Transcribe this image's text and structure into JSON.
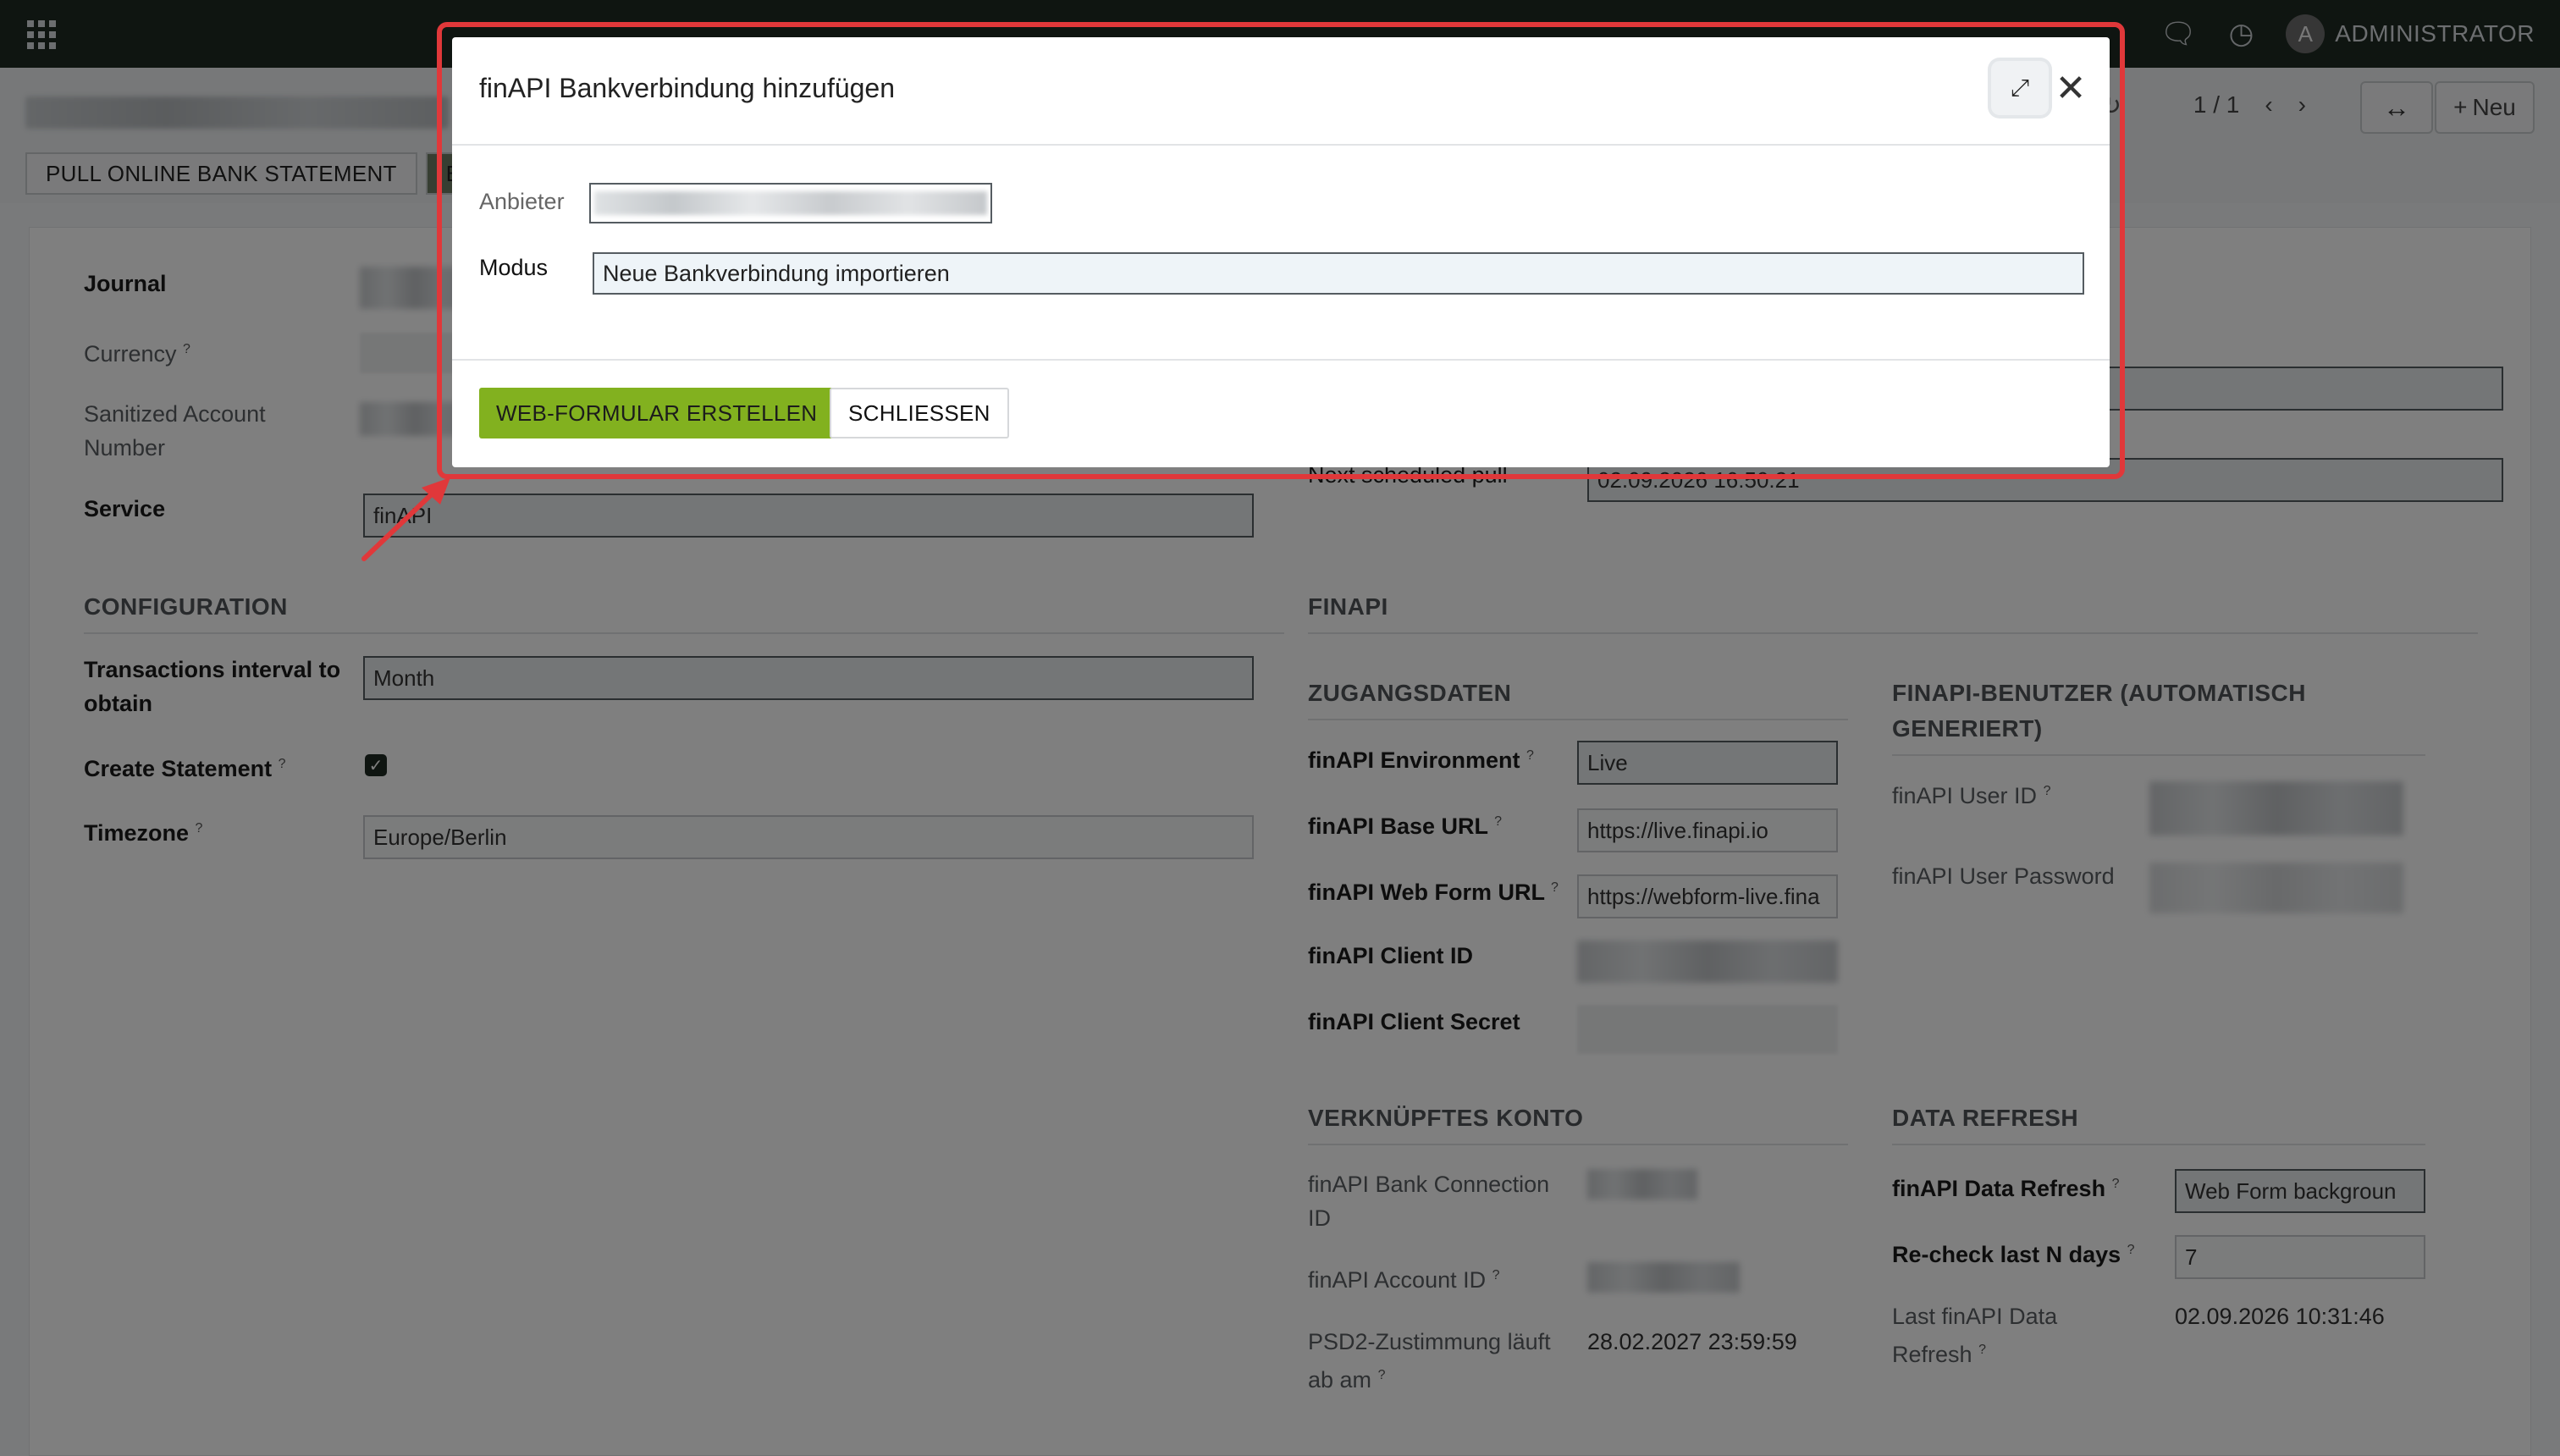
{
  "navbar": {
    "user_initial": "A",
    "user_name": "ADMINISTRATOR"
  },
  "control": {
    "pager": "1 / 1",
    "new_label": "Neu",
    "status_buttons": [
      "PULL ONLINE BANK STATEMENT",
      "B"
    ]
  },
  "form": {
    "journal_label": "Journal",
    "currency_label": "Currency",
    "sanitized_label_1": "Sanitized Account",
    "sanitized_label_2": "Number",
    "service_label": "Service",
    "service_value": "finAPI",
    "next_pull_label": "Next scheduled pull",
    "next_pull_value": "02.09.2026 16:50:21",
    "configuration_title": "CONFIGURATION",
    "interval_label_1": "Transactions interval to",
    "interval_label_2": "obtain",
    "interval_value": "Month",
    "create_statement_label": "Create Statement",
    "timezone_label": "Timezone",
    "timezone_value": "Europe/Berlin",
    "finapi_title": "FINAPI",
    "zugangsdaten_title": "ZUGANGSDATEN",
    "env_label": "finAPI Environment",
    "env_value": "Live",
    "base_url_label": "finAPI Base URL",
    "base_url_value": "https://live.finapi.io",
    "webform_url_label": "finAPI Web Form URL",
    "webform_url_value": "https://webform-live.fina",
    "client_id_label": "finAPI Client ID",
    "client_secret_label": "finAPI Client Secret",
    "benutzer_title_1": "FINAPI-BENUTZER (AUTOMATISCH",
    "benutzer_title_2": "GENERIERT)",
    "user_id_label": "finAPI User ID",
    "user_password_label": "finAPI User Password",
    "konto_title": "VERKNÜPFTES KONTO",
    "bank_conn_label_1": "finAPI Bank Connection",
    "bank_conn_label_2": "ID",
    "account_id_label": "finAPI Account ID",
    "psd2_label_1": "PSD2-Zustimmung läuft",
    "psd2_label_2": "ab am",
    "psd2_value": "28.02.2027 23:59:59",
    "refresh_title": "DATA REFRESH",
    "data_refresh_label": "finAPI Data Refresh",
    "data_refresh_value": "Web Form backgroun",
    "recheck_label": "Re-check last N days",
    "recheck_value": "7",
    "last_refresh_label_1": "Last finAPI Data",
    "last_refresh_label_2": "Refresh",
    "last_refresh_value": "02.09.2026 10:31:46",
    "help_mark": "?"
  },
  "modal": {
    "title": "finAPI Bankverbindung hinzufügen",
    "anbieter_label": "Anbieter",
    "modus_label": "Modus",
    "modus_value": "Neue Bankverbindung importieren",
    "primary_button": "WEB-FORMULAR ERSTELLEN",
    "secondary_button": "SCHLIESSEN"
  },
  "colors": {
    "navbar": "#1f2a22",
    "primary_button": "#82b11f",
    "highlight": "#e0383a"
  }
}
